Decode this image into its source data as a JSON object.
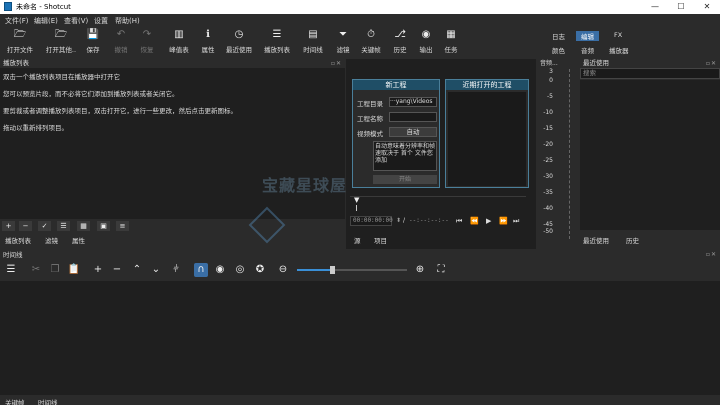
{
  "window": {
    "title": "未命名 - Shotcut",
    "min": "—",
    "max": "☐",
    "close": "✕"
  },
  "menu": [
    "文件(F)",
    "编辑(E)",
    "查看(V)",
    "设置",
    "帮助(H)"
  ],
  "toolbar": [
    {
      "label": "打开文件",
      "icon": "folder-open-icon",
      "glyph": "🗁"
    },
    {
      "label": "打开其他..",
      "icon": "open-other-icon",
      "glyph": "🗁"
    },
    {
      "label": "保存",
      "icon": "save-icon",
      "glyph": "💾"
    },
    {
      "label": "撤销",
      "icon": "undo-icon",
      "glyph": "↶"
    },
    {
      "label": "恢复",
      "icon": "redo-icon",
      "glyph": "↷"
    },
    {
      "label": "峰值表",
      "icon": "peak-meter-icon",
      "glyph": "▥"
    },
    {
      "label": "属性",
      "icon": "properties-icon",
      "glyph": "ℹ"
    },
    {
      "label": "最近使用",
      "icon": "recent-icon",
      "glyph": "◷"
    },
    {
      "label": "播放列表",
      "icon": "playlist-icon",
      "glyph": "☰"
    },
    {
      "label": "时间线",
      "icon": "timeline-icon",
      "glyph": "▤"
    },
    {
      "label": "滤镜",
      "icon": "filter-icon",
      "glyph": "⏷"
    },
    {
      "label": "关键帧",
      "icon": "keyframe-icon",
      "glyph": "⏱"
    },
    {
      "label": "历史",
      "icon": "history-icon",
      "glyph": "⎇"
    },
    {
      "label": "输出",
      "icon": "export-icon",
      "glyph": "◉"
    },
    {
      "label": "任务",
      "icon": "jobs-icon",
      "glyph": "▦"
    }
  ],
  "modes": {
    "top": [
      "日志",
      "编辑",
      "FX"
    ],
    "bottom": [
      "颜色",
      "音频",
      "播放器"
    ],
    "active": "编辑"
  },
  "playlist": {
    "title": "播放列表",
    "lines": [
      "双击一个播放列表项目在播放器中打开它",
      "您可以预览片段，而不必将它们添加到播放列表或者关闭它。",
      "要剪裁或者调整播放列表项目，双击打开它，进行一些更改，然后点击更新图标。",
      "拖动以重新排列项目。"
    ],
    "tabs": [
      "播放列表",
      "滤镜",
      "属性"
    ]
  },
  "new_project": {
    "title": "新工程",
    "dir_label": "工程目录",
    "dir_value": "···yang\\Videos",
    "name_label": "工程名称",
    "name_value": "",
    "mode_label": "视频模式",
    "mode_value": "自动",
    "note": "自动意味着分辨率和帧速取决于 首个 文件您 添加",
    "start": "开始"
  },
  "recent_projects": {
    "title": "近期打开的工程"
  },
  "transport": {
    "current": "00:00:00:00",
    "sep": "/",
    "total": "--:--:--:--",
    "tabs": [
      "源",
      "项目"
    ]
  },
  "audio": {
    "title": "音频...",
    "scale": [
      "3",
      "0",
      "-5",
      "-10",
      "-15",
      "-20",
      "-25",
      "-30",
      "-35",
      "-40",
      "-45",
      "-50"
    ]
  },
  "recent": {
    "title": "最近使用",
    "search_placeholder": "搜索",
    "tabs": [
      "最近使用",
      "历史"
    ]
  },
  "timeline": {
    "title": "时间线"
  },
  "bottom_tabs": [
    "关键帧",
    "时间线"
  ],
  "watermark": "宝藏星球屋"
}
